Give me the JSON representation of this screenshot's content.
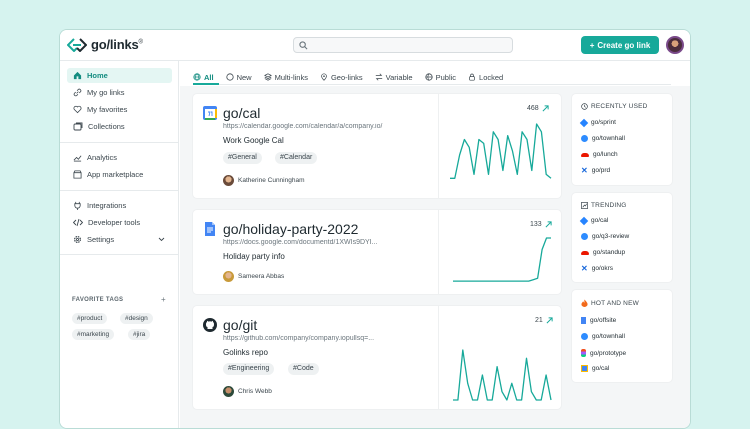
{
  "header": {
    "logo_text": "go/links",
    "logo_mark": "®",
    "search_placeholder": "",
    "create_button": "Create go link",
    "create_plus": "+"
  },
  "sidebar": {
    "items": [
      {
        "label": "Home",
        "icon": "home-icon",
        "active": true
      },
      {
        "label": "My go links",
        "icon": "link-icon"
      },
      {
        "label": "My favorites",
        "icon": "heart-icon"
      },
      {
        "label": "Collections",
        "icon": "collections-icon"
      },
      {
        "label": "Analytics",
        "icon": "analytics-icon"
      },
      {
        "label": "App marketplace",
        "icon": "store-icon"
      },
      {
        "label": "Integrations",
        "icon": "plug-icon"
      },
      {
        "label": "Developer tools",
        "icon": "code-icon"
      },
      {
        "label": "Settings",
        "icon": "gear-icon"
      }
    ],
    "favorite_tags_title": "FAVORITE TAGS",
    "favorite_tags_add": "+",
    "tags": [
      "#product",
      "#design",
      "#marketing",
      "#jira"
    ]
  },
  "filters": [
    "All",
    "New",
    "Multi-links",
    "Geo-links",
    "Variable",
    "Public",
    "Locked"
  ],
  "cards": [
    {
      "title": "go/cal",
      "url": "https://calendar.google.com/calendar/a/company.io/",
      "description": "Work Google Cal",
      "tags": [
        "#General",
        "#Calendar"
      ],
      "owner": "Katherine Cunningham",
      "count": "468",
      "icon": "google-calendar-icon",
      "spark": [
        2,
        2,
        8,
        12,
        10,
        3,
        12,
        11,
        3,
        14,
        12,
        4,
        13,
        9,
        3,
        14,
        12,
        4,
        16,
        14,
        3,
        2
      ]
    },
    {
      "title": "go/holiday-party-2022",
      "url": "https://docs.google.com/documentd/1XWIs9DYI...",
      "description": "Holiday party info",
      "tags": [],
      "owner": "Sameera Abbas",
      "count": "133",
      "icon": "google-docs-icon",
      "spark": [
        1,
        1,
        1,
        1,
        1,
        1,
        1,
        1,
        1,
        1,
        1,
        1,
        1,
        1,
        1,
        1,
        1,
        1,
        1.5,
        2,
        12,
        16,
        16
      ]
    },
    {
      "title": "go/git",
      "url": "https://github.com/company/company.iopullsq=...",
      "description": "Golinks repo",
      "tags": [
        "#Engineering",
        "#Code"
      ],
      "owner": "Chris Webb",
      "count": "21",
      "icon": "github-icon",
      "spark": [
        0,
        0,
        12,
        4,
        0,
        0,
        6,
        0,
        0,
        8,
        2,
        0,
        4,
        0,
        0,
        10,
        2,
        0,
        0,
        6,
        0
      ]
    }
  ],
  "recently_used": {
    "title": "RECENTLY USED",
    "items": [
      {
        "label": "go/sprint",
        "icon": "jira-icon"
      },
      {
        "label": "go/townhall",
        "icon": "zoom-icon"
      },
      {
        "label": "go/lunch",
        "icon": "doordash-icon"
      },
      {
        "label": "go/prd",
        "icon": "confluence-icon"
      }
    ]
  },
  "trending": {
    "title": "TRENDING",
    "items": [
      {
        "label": "go/cal",
        "icon": "jira-icon"
      },
      {
        "label": "go/q3-review",
        "icon": "zoom-icon"
      },
      {
        "label": "go/standup",
        "icon": "doordash-icon"
      },
      {
        "label": "go/okrs",
        "icon": "confluence-icon"
      }
    ]
  },
  "hot_and_new": {
    "title": "HOT AND NEW",
    "items": [
      {
        "label": "go/offsite",
        "icon": "docs-icon"
      },
      {
        "label": "go/townhall",
        "icon": "zoom-icon"
      },
      {
        "label": "go/prototype",
        "icon": "figma-icon"
      },
      {
        "label": "go/cal",
        "icon": "calendar-icon"
      }
    ]
  },
  "colors": {
    "accent": "#17a99a",
    "accent_light": "#e4f6f3"
  }
}
